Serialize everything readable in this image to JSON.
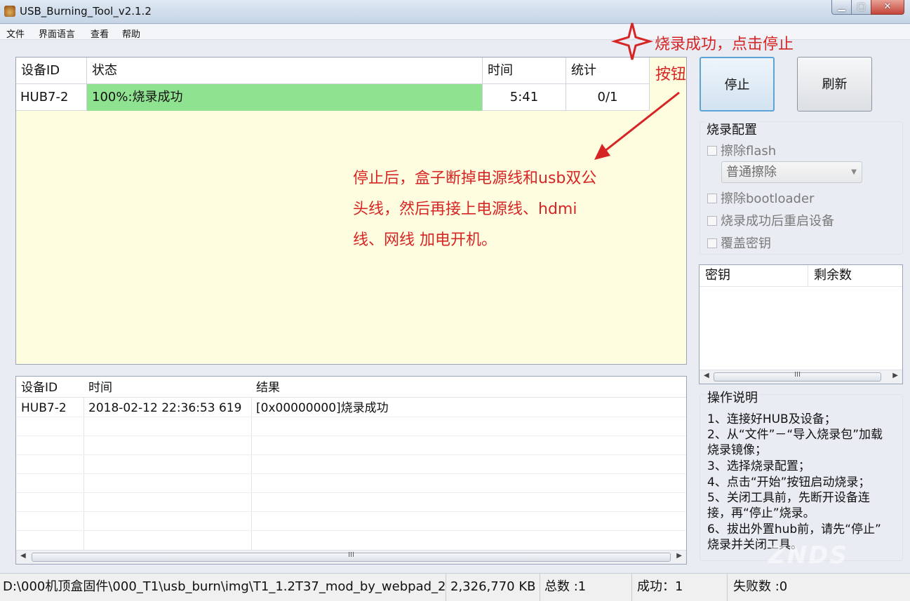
{
  "window": {
    "title": "USB_Burning_Tool_v2.1.2"
  },
  "menu": {
    "file": "文件",
    "language": "界面语言",
    "view": "查看",
    "help": "帮助"
  },
  "main_grid": {
    "headers": {
      "device_id": "设备ID",
      "status": "状态",
      "time": "时间",
      "count": "统计"
    },
    "row": {
      "device_id": "HUB7-2",
      "status": "100%:烧录成功",
      "time": "5:41",
      "count": "0/1"
    }
  },
  "buttons": {
    "stop": "停止",
    "refresh": "刷新"
  },
  "config": {
    "title": "烧录配置",
    "erase_flash": "擦除flash",
    "erase_mode": "普通擦除",
    "erase_bootloader": "擦除bootloader",
    "reboot_after": "烧录成功后重启设备",
    "overwrite_key": "覆盖密钥"
  },
  "key_list": {
    "headers": {
      "key": "密钥",
      "remaining": "剩余数"
    },
    "grip": "III"
  },
  "log_grid": {
    "headers": {
      "device_id": "设备ID",
      "time": "时间",
      "result": "结果"
    },
    "row": {
      "device_id": "HUB7-2",
      "time": "2018-02-12 22:36:53 619",
      "result": "[0x00000000]烧录成功"
    },
    "grip": "III"
  },
  "instructions": {
    "title": "操作说明",
    "lines": [
      "1、连接好HUB及设备；",
      "2、从“文件”－“导入烧录包”加载",
      "烧录镜像；",
      "3、选择烧录配置；",
      "4、点击“开始”按钮启动烧录；",
      "5、关闭工具前，先断开设备连",
      "接，再“停止”烧录。",
      "6、拔出外置hub前，请先“停止”",
      "烧录并关闭工具。"
    ]
  },
  "status_bar": {
    "path": "D:\\000机顶盒固件\\000_T1\\usb_burn\\img\\T1_1.2T37_mod_by_webpad_2",
    "size": "2,326,770 KB",
    "total": "总数 :1",
    "success": "成功：1",
    "failed": "失败数 :0"
  },
  "annotations": {
    "top_line1": "烧录成功，点击停止",
    "top_line2": "按钮",
    "body": [
      "停止后，盒子断掉电源线和usb双公",
      "头线，然后再接上电源线、hdmi",
      "线、网线 加电开机。"
    ],
    "watermark": "ZNDS"
  },
  "colors": {
    "status_success": "#8fe28f",
    "grid_bg": "#fffde0",
    "annotation": "#d62525"
  }
}
